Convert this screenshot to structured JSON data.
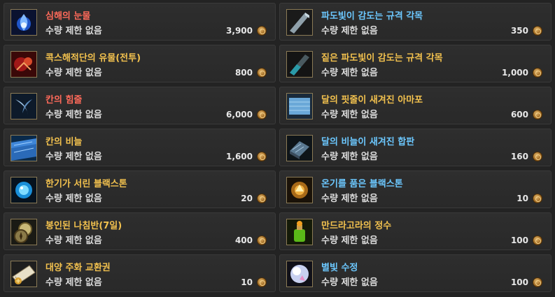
{
  "colors": {
    "red": "#ff6a5a",
    "yellow": "#f2c14e",
    "blue": "#6cc8ff",
    "white": "#e8e8e8"
  },
  "left_items": [
    {
      "name": "심해의 눈물",
      "limit": "수량 제한 없음",
      "price": "3,900",
      "name_color": "#ff6a5a",
      "icon": "blue-flame-icon"
    },
    {
      "name": "콕스해적단의 유물(전투)",
      "limit": "수량 제한 없음",
      "price": "800",
      "name_color": "#f2c14e",
      "icon": "red-relic-icon"
    },
    {
      "name": "칸의 힘줄",
      "limit": "수량 제한 없음",
      "price": "6,000",
      "name_color": "#ff6a5a",
      "icon": "tail-fin-icon"
    },
    {
      "name": "칸의 비늘",
      "limit": "수량 제한 없음",
      "price": "1,600",
      "name_color": "#f2c14e",
      "icon": "blue-scale-icon"
    },
    {
      "name": "한기가 서린 블랙스톤",
      "limit": "수량 제한 없음",
      "price": "20",
      "name_color": "#f2c14e",
      "icon": "cold-blackstone-icon"
    },
    {
      "name": "봉인된 나침반(7일)",
      "limit": "수량 제한 없음",
      "price": "400",
      "name_color": "#f2c14e",
      "icon": "compass-icon"
    },
    {
      "name": "대양 주화 교환권",
      "limit": "수량 제한 없음",
      "price": "10",
      "name_color": "#f2c14e",
      "icon": "coupon-icon"
    }
  ],
  "right_items": [
    {
      "name": "파도빛이 감도는 규격 각목",
      "limit": "수량 제한 없음",
      "price": "350",
      "name_color": "#6cc8ff",
      "icon": "timber-icon"
    },
    {
      "name": "짙은 파도빛이 감도는 규격 각목",
      "limit": "수량 제한 없음",
      "price": "1,000",
      "name_color": "#f2c14e",
      "icon": "dark-timber-icon"
    },
    {
      "name": "달의 핏줄이 새겨진 아마포",
      "limit": "수량 제한 없음",
      "price": "600",
      "name_color": "#f2c14e",
      "icon": "linen-icon"
    },
    {
      "name": "달의 비늘이 새겨진 합판",
      "limit": "수량 제한 없음",
      "price": "160",
      "name_color": "#6cc8ff",
      "icon": "plywood-icon"
    },
    {
      "name": "온기를 품은 블랙스톤",
      "limit": "수량 제한 없음",
      "price": "10",
      "name_color": "#6cc8ff",
      "icon": "warm-blackstone-icon"
    },
    {
      "name": "만드라고라의 정수",
      "limit": "수량 제한 없음",
      "price": "100",
      "name_color": "#f2c14e",
      "icon": "mandragora-essence-icon"
    },
    {
      "name": "별빛 수정",
      "limit": "수량 제한 없음",
      "price": "100",
      "name_color": "#6cc8ff",
      "icon": "starlight-crystal-icon"
    }
  ]
}
